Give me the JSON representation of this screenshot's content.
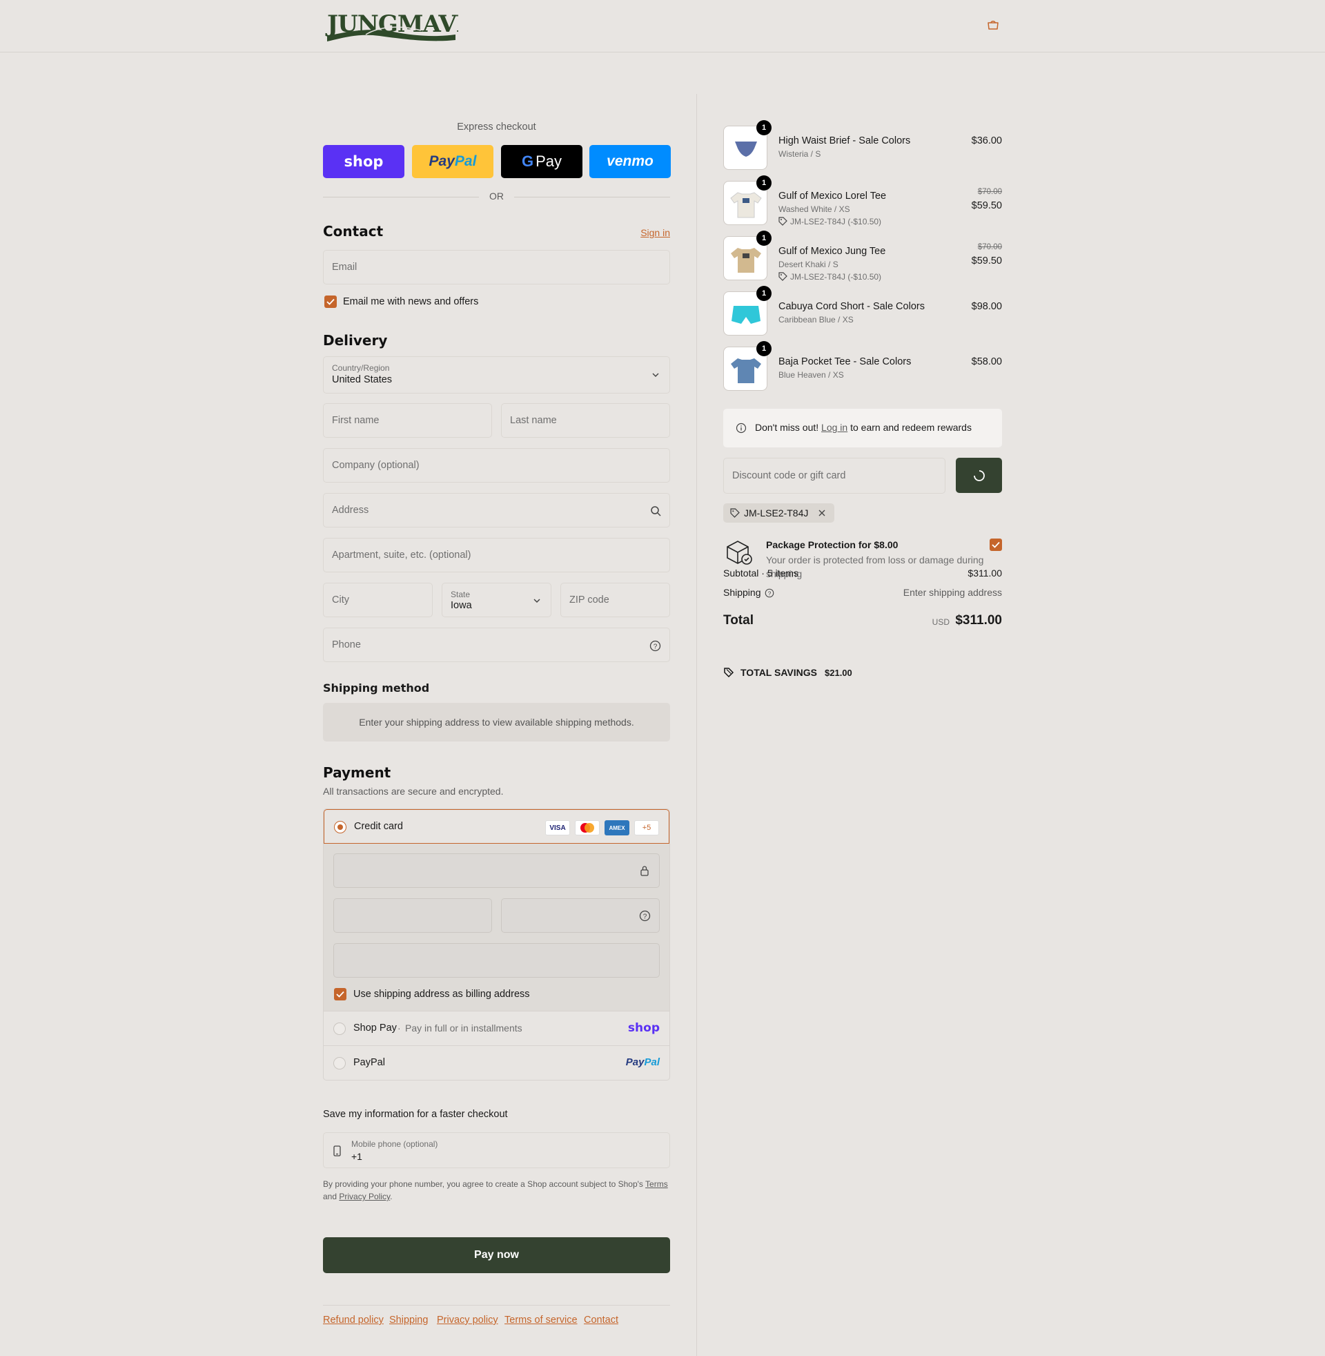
{
  "brand": {
    "name": "JUNGMAVEN",
    "accent": "#c5652b",
    "dark_button": "#344230"
  },
  "express": {
    "title": "Express checkout",
    "or": "OR",
    "shop_label": "shop",
    "paypal_label_1": "Pay",
    "paypal_label_2": "Pal",
    "gpay_label": "Pay",
    "venmo_label": "venmo"
  },
  "contact": {
    "heading": "Contact",
    "sign_in": "Sign in",
    "email_placeholder": "Email",
    "newsletter_label": "Email me with news and offers"
  },
  "delivery": {
    "heading": "Delivery",
    "country_label": "Country/Region",
    "country_value": "United States",
    "first_name": "First name",
    "last_name": "Last name",
    "company": "Company (optional)",
    "address": "Address",
    "apartment": "Apartment, suite, etc. (optional)",
    "city": "City",
    "state_label": "State",
    "state_value": "Iowa",
    "zip": "ZIP code",
    "phone": "Phone"
  },
  "shipping_method": {
    "heading": "Shipping method",
    "message": "Enter your shipping address to view available shipping methods."
  },
  "payment": {
    "heading": "Payment",
    "subtitle": "All transactions are secure and encrypted.",
    "credit_card": "Credit card",
    "cards": [
      "VISA",
      "MC",
      "AMEX",
      "+5"
    ],
    "billing_label": "Use shipping address as billing address",
    "shop_pay": "Shop Pay",
    "shop_pay_sub": "Pay in full or in installments",
    "shop_pay_logo": "shop",
    "paypal": "PayPal",
    "paypal_logo_1": "Pay",
    "paypal_logo_2": "Pal"
  },
  "save_info": {
    "heading": "Save my information for a faster checkout",
    "mobile_label": "Mobile phone (optional)",
    "mobile_value": "+1",
    "legal_1": "By providing your phone number, you agree to create a Shop account subject to Shop's",
    "terms": "Terms",
    "and": "and",
    "privacy": "Privacy Policy",
    "period": "."
  },
  "pay_now": "Pay now",
  "footer": [
    "Refund policy",
    "Shipping",
    "Privacy policy",
    "Terms of service",
    "Contact"
  ],
  "cart": {
    "items": [
      {
        "qty": "1",
        "name": "High Waist Brief - Sale Colors",
        "variant": "Wisteria / S",
        "price": "$36.00",
        "thumb_color": "#5b6fa8"
      },
      {
        "qty": "1",
        "name": "Gulf of Mexico Lorel Tee",
        "variant": "Washed White / XS",
        "discount": "JM-LSE2-T84J (-$10.50)",
        "old_price": "$70.00",
        "price": "$59.50",
        "thumb_color": "#ece8df"
      },
      {
        "qty": "1",
        "name": "Gulf of Mexico Jung Tee",
        "variant": "Desert Khaki / S",
        "discount": "JM-LSE2-T84J (-$10.50)",
        "old_price": "$70.00",
        "price": "$59.50",
        "thumb_color": "#d2b98f"
      },
      {
        "qty": "1",
        "name": "Cabuya Cord Short - Sale Colors",
        "variant": "Caribbean Blue / XS",
        "price": "$98.00",
        "thumb_color": "#2fc7d9"
      },
      {
        "qty": "1",
        "name": "Baja Pocket Tee - Sale Colors",
        "variant": "Blue Heaven / XS",
        "price": "$58.00",
        "thumb_color": "#5f86b3"
      }
    ],
    "rewards_1": "Don't miss out!",
    "rewards_link": "Log in",
    "rewards_2": "to earn and redeem rewards",
    "discount_placeholder": "Discount code or gift card",
    "applied_code": "JM-LSE2-T84J",
    "protection_title": "Package Protection for $8.00",
    "protection_desc": "Your order is protected from loss or damage during shipping",
    "subtotal_label": "Subtotal · 5 items",
    "subtotal_value": "$311.00",
    "shipping_label": "Shipping",
    "shipping_value": "Enter shipping address",
    "total_label": "Total",
    "currency": "USD",
    "total_value": "$311.00",
    "savings_label": "TOTAL SAVINGS",
    "savings_value": "$21.00"
  }
}
